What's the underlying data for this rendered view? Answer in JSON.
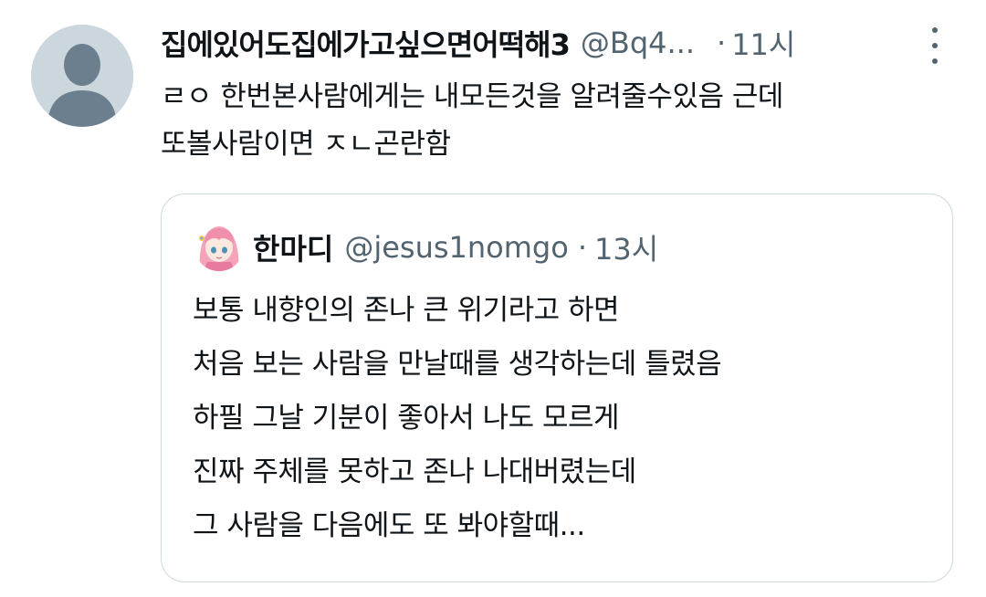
{
  "tweet": {
    "display_name": "집에있어도집에가고싶으면어떡해3",
    "handle": "@Bq4...",
    "separator": "·",
    "time": "11시",
    "text_lines": [
      "ㄹㅇ 한번본사람에게는 내모든것을 알려줄수있음 근데",
      "또볼사람이면 ㅈㄴ곤란함"
    ]
  },
  "quote": {
    "display_name": "한마디",
    "handle": "@jesus1nomgo",
    "separator": "·",
    "time": "13시",
    "text_lines": [
      "보통 내향인의 존나 큰 위기라고 하면",
      "처음 보는 사람을 만날때를 생각하는데 틀렸음",
      "하필 그날 기분이 좋아서 나도 모르게",
      "진짜 주체를 못하고 존나 나대버렸는데",
      "그 사람을 다음에도 또 봐야할때..."
    ]
  },
  "icons": {
    "avatar": "default-user-avatar",
    "more": "more-vertical-icon",
    "quote_avatar": "anime-girl-pink-hair-avatar"
  },
  "colors": {
    "text": "#0f1419",
    "muted": "#536471",
    "border": "#cfd9de",
    "avatar_bg": "#ccd6dd",
    "avatar_fg": "#6b7f8e"
  }
}
